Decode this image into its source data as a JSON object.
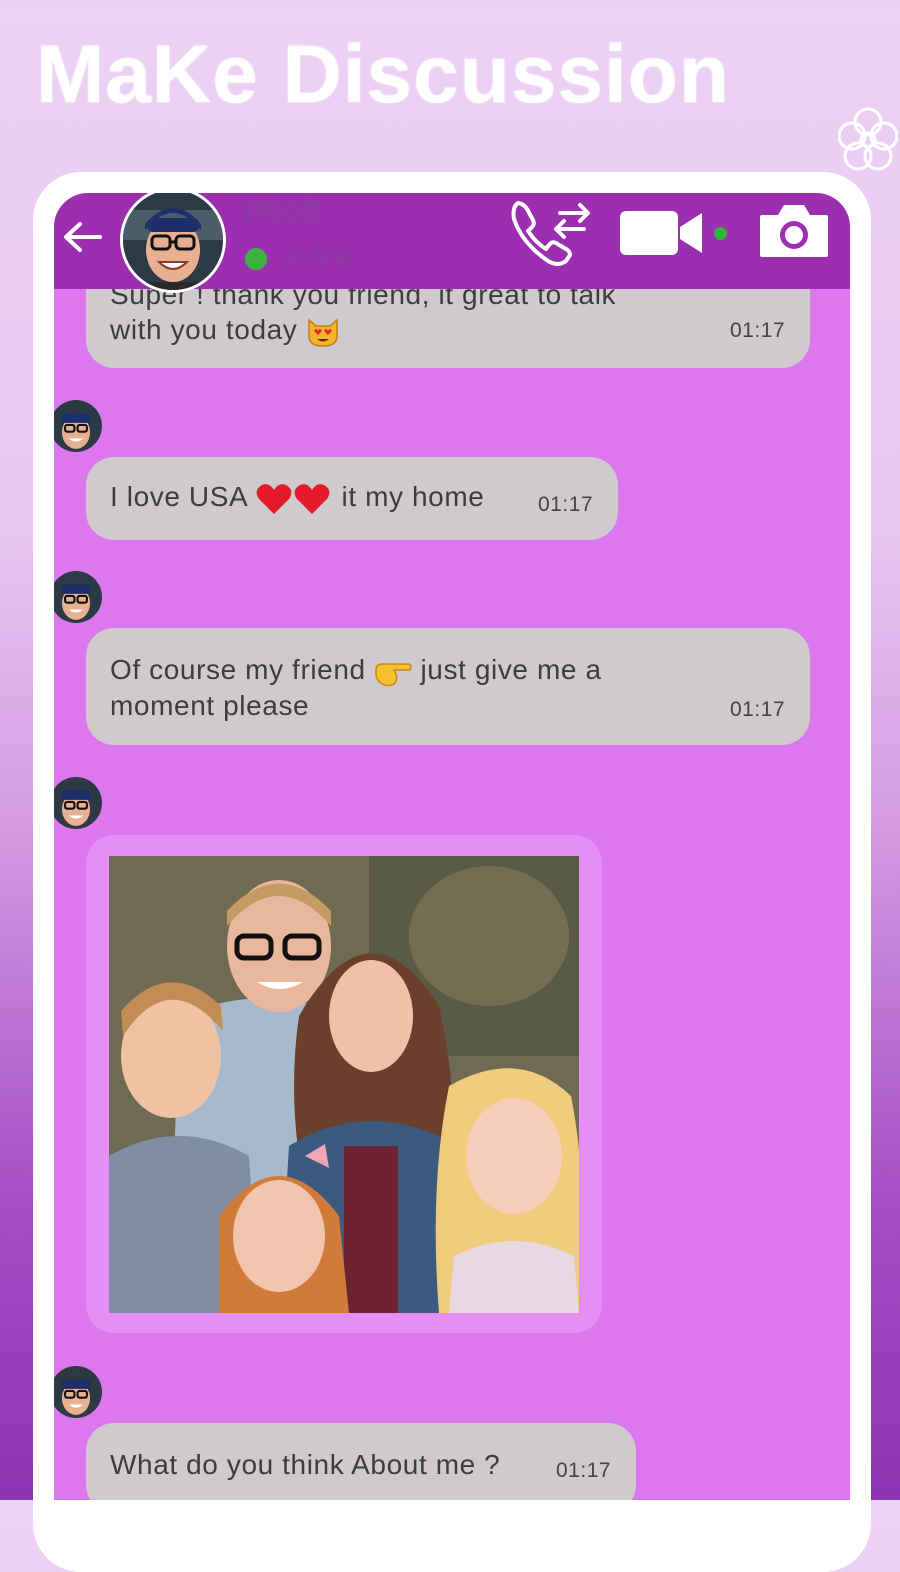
{
  "headline": "MaKe Discussion",
  "header": {
    "contact_name": "noob",
    "status": "online"
  },
  "messages": [
    {
      "line1": "Super ! thank you friend, it great to talk",
      "line2": "with you today",
      "emoji": "smiling-cat-heart-eyes",
      "time": "01:17"
    },
    {
      "before": "I love USA",
      "emoji": "two-red-hearts",
      "after": "it my home",
      "time": "01:17"
    },
    {
      "before": "Of course my friend",
      "emoji": "pointing-right-hand",
      "after": "just give me a",
      "line2": "moment please",
      "time": "01:17"
    },
    {
      "type": "image",
      "description_icon": "family-photo"
    },
    {
      "text": "What do you think About me ?",
      "time": "01:17"
    }
  ],
  "colors": {
    "header": "#9b2fb0",
    "chat_background": "#dc77f0",
    "bubble": "#cfcacd",
    "online": "#3cb33f"
  }
}
